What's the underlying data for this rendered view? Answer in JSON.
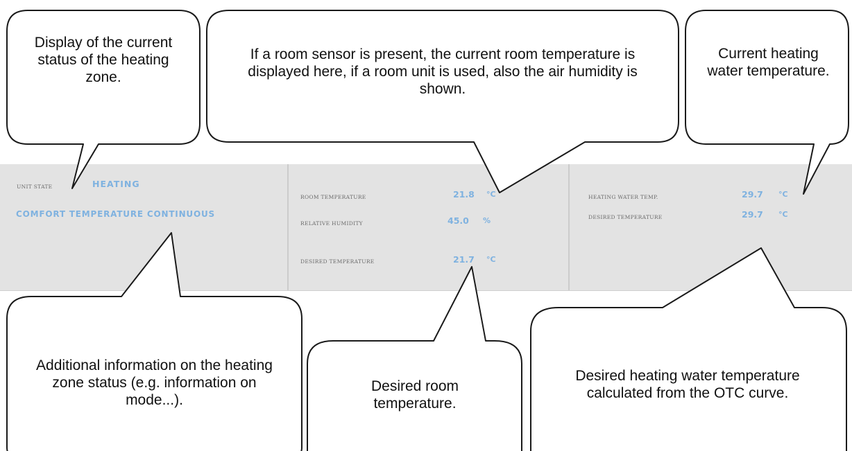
{
  "zone": {
    "unit_state_label": "UNIT STATE",
    "unit_state_value": "HEATING",
    "additional_info": "COMFORT TEMPERATURE CONTINUOUS"
  },
  "room": {
    "room_temp_label": "ROOM TEMPERATURE",
    "room_temp_value": "21.8",
    "room_temp_unit": "°C",
    "humidity_label": "RELATIVE HUMIDITY",
    "humidity_value": "45.0",
    "humidity_unit": "%",
    "desired_temp_label": "DESIRED TEMPERATURE",
    "desired_temp_value": "21.7",
    "desired_temp_unit": "°C"
  },
  "water": {
    "water_temp_label": "HEATING WATER TEMP.",
    "water_temp_value": "29.7",
    "water_temp_unit": "°C",
    "desired_temp_label": "DESIRED TEMPERATURE",
    "desired_temp_value": "29.7",
    "desired_temp_unit": "°C"
  },
  "callouts": {
    "zone_status": "Display of the current status of the heating zone.",
    "room_sensor": "If a room sensor is present, the current room temperature is displayed here, if a room unit is used, also the air humidity is shown.",
    "water_temp": "Current heating water temperature.",
    "additional_info": "Additional information on the heating zone status (e.g. information on mode...).",
    "desired_room": "Desired room temperature.",
    "desired_water": "Desired heating water temperature calculated from the OTC curve."
  }
}
